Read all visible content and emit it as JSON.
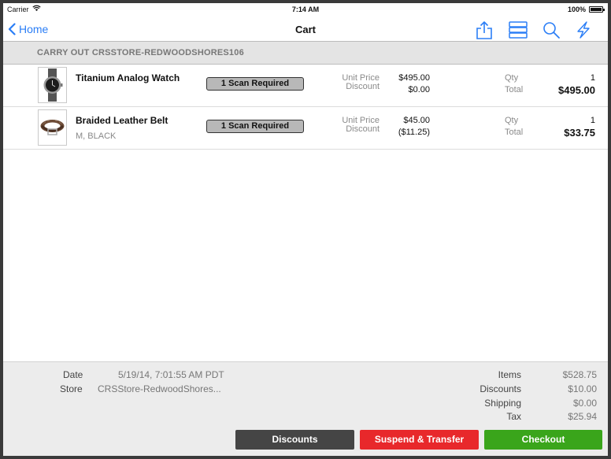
{
  "status_bar": {
    "carrier": "Carrier",
    "time": "7:14 AM",
    "battery": "100%",
    "battery_level": 1.0
  },
  "nav": {
    "back_label": "Home",
    "title": "Cart",
    "icons": [
      "share-icon",
      "list-icon",
      "search-icon",
      "lightning-icon"
    ]
  },
  "section": {
    "title": "CARRY OUT CRSSTORE-REDWOODSHORES106"
  },
  "labels": {
    "unit_price": "Unit Price",
    "discount": "Discount",
    "qty": "Qty",
    "total": "Total",
    "scan_required": "1 Scan Required"
  },
  "items": [
    {
      "name": "Titanium Analog Watch",
      "variant": "",
      "unit_price": "$495.00",
      "discount": "$0.00",
      "qty": "1",
      "total": "$495.00",
      "image": "watch-image"
    },
    {
      "name": "Braided Leather Belt",
      "variant": "M, BLACK",
      "unit_price": "$45.00",
      "discount": "($11.25)",
      "qty": "1",
      "total": "$33.75",
      "image": "belt-image"
    }
  ],
  "footer": {
    "date_label": "Date",
    "date_value": "5/19/14, 7:01:55 AM PDT",
    "store_label": "Store",
    "store_value": "CRSStore-RedwoodShores...",
    "summary": {
      "items_label": "Items",
      "items_value": "$528.75",
      "discounts_label": "Discounts",
      "discounts_value": "$10.00",
      "shipping_label": "Shipping",
      "shipping_value": "$0.00",
      "tax_label": "Tax",
      "tax_value": "$25.94"
    },
    "buttons": {
      "discounts": "Discounts",
      "suspend": "Suspend & Transfer",
      "checkout": "Checkout"
    }
  },
  "colors": {
    "accent": "#2b7ef6",
    "discounts_button": "#454545",
    "suspend_button": "#e8282b",
    "checkout_button": "#3aa51b"
  }
}
